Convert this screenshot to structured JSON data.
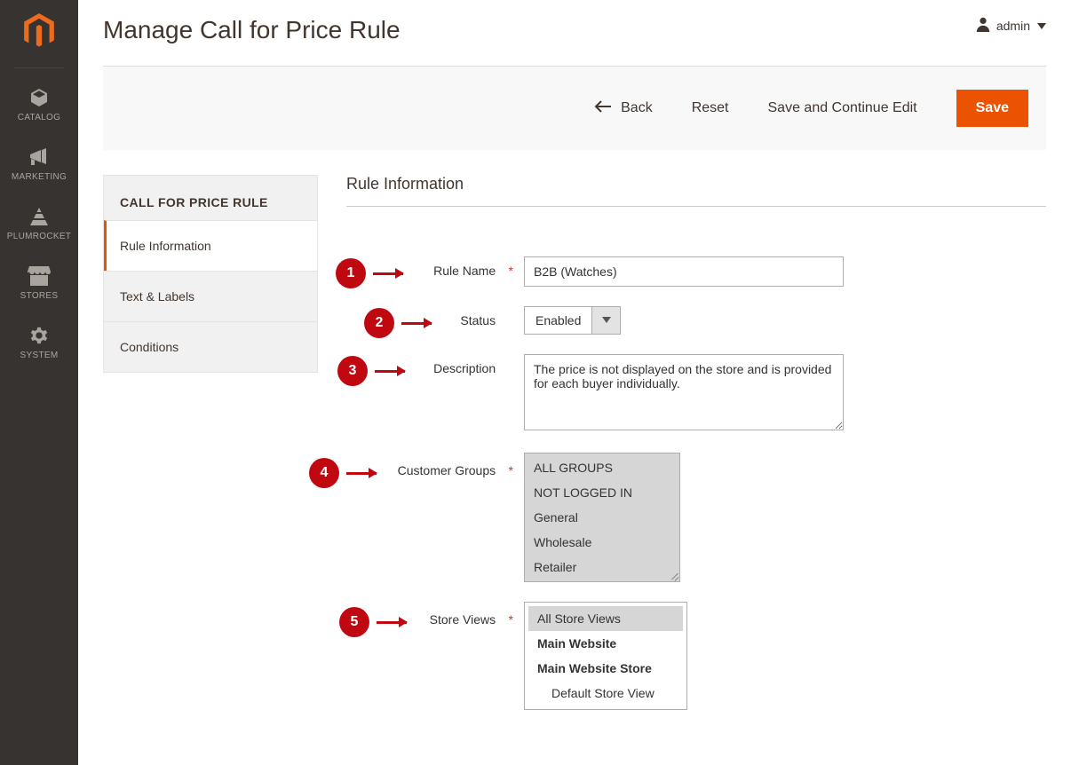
{
  "header": {
    "page_title": "Manage Call for Price Rule",
    "admin_user": "admin"
  },
  "nav": {
    "items": [
      {
        "label": "CATALOG",
        "icon": "cube"
      },
      {
        "label": "MARKETING",
        "icon": "megaphone"
      },
      {
        "label": "PLUMROCKET",
        "icon": "pyramid"
      },
      {
        "label": "STORES",
        "icon": "storefront"
      },
      {
        "label": "SYSTEM",
        "icon": "gear"
      }
    ]
  },
  "actions": {
    "back": "Back",
    "reset": "Reset",
    "save_continue": "Save and Continue Edit",
    "save": "Save"
  },
  "tabs": {
    "title": "CALL FOR PRICE RULE",
    "items": [
      {
        "label": "Rule Information",
        "active": true
      },
      {
        "label": "Text & Labels",
        "active": false
      },
      {
        "label": "Conditions",
        "active": false
      }
    ]
  },
  "section": {
    "title": "Rule Information"
  },
  "annotations": [
    "1",
    "2",
    "3",
    "4",
    "5"
  ],
  "fields": {
    "rule_name": {
      "label": "Rule Name",
      "value": "B2B (Watches)",
      "required": true
    },
    "status": {
      "label": "Status",
      "value": "Enabled"
    },
    "description": {
      "label": "Description",
      "value": "The price is not displayed on the store and is provided for each buyer individually."
    },
    "customer_groups": {
      "label": "Customer Groups",
      "required": true,
      "options": [
        "ALL GROUPS",
        "NOT LOGGED IN",
        "General",
        "Wholesale",
        "Retailer"
      ]
    },
    "store_views": {
      "label": "Store Views",
      "required": true,
      "options": [
        {
          "label": "All Store Views",
          "selected": true,
          "bold": false,
          "indent": false
        },
        {
          "label": "Main Website",
          "selected": false,
          "bold": true,
          "indent": false
        },
        {
          "label": "Main Website Store",
          "selected": false,
          "bold": true,
          "indent": false
        },
        {
          "label": "Default Store View",
          "selected": false,
          "bold": false,
          "indent": true
        }
      ]
    }
  }
}
